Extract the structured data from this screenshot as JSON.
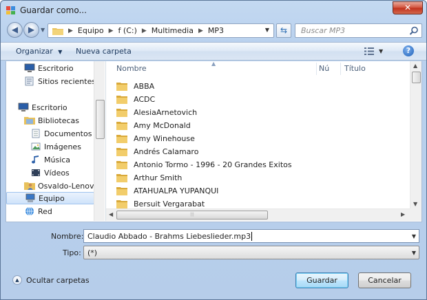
{
  "window": {
    "title": "Guardar como..."
  },
  "address": {
    "crumbs": [
      "Equipo",
      "f (C:)",
      "Multimedia",
      "MP3"
    ],
    "search_placeholder": "Buscar MP3"
  },
  "toolbar": {
    "organize": "Organizar",
    "new_folder": "Nueva carpeta"
  },
  "nav": {
    "items": [
      {
        "label": "Escritorio",
        "icon": "desktop-icon"
      },
      {
        "label": "Sitios recientes",
        "icon": "recent-places-icon"
      },
      {
        "label": "Escritorio",
        "icon": "desktop-icon"
      },
      {
        "label": "Bibliotecas",
        "icon": "libraries-icon"
      },
      {
        "label": "Documentos",
        "icon": "documents-icon"
      },
      {
        "label": "Imágenes",
        "icon": "pictures-icon"
      },
      {
        "label": "Música",
        "icon": "music-icon"
      },
      {
        "label": "Vídeos",
        "icon": "videos-icon"
      },
      {
        "label": "Osvaldo-Lenovo",
        "icon": "user-icon"
      },
      {
        "label": "Equipo",
        "icon": "computer-icon",
        "selected": true
      },
      {
        "label": "Red",
        "icon": "network-icon"
      }
    ]
  },
  "files": {
    "columns": {
      "name": "Nombre",
      "number": "Nú",
      "title": "Título"
    },
    "items": [
      "ABBA",
      "ACDC",
      "AlesiaArnetovich",
      "Amy McDonald",
      "Amy Winehouse",
      "Andrés Calamaro",
      "Antonio Tormo - 1996 - 20 Grandes Exitos",
      "Arthur Smith",
      "ATAHUALPA YUPANQUI",
      "Bersuit Vergarabat"
    ]
  },
  "form": {
    "name_label": "Nombre:",
    "name_value": "Claudio Abbado - Brahms Liebeslieder.mp3",
    "type_label": "Tipo:",
    "type_value": "(*)"
  },
  "footer": {
    "hide_folders": "Ocultar carpetas",
    "save": "Guardar",
    "cancel": "Cancelar"
  }
}
